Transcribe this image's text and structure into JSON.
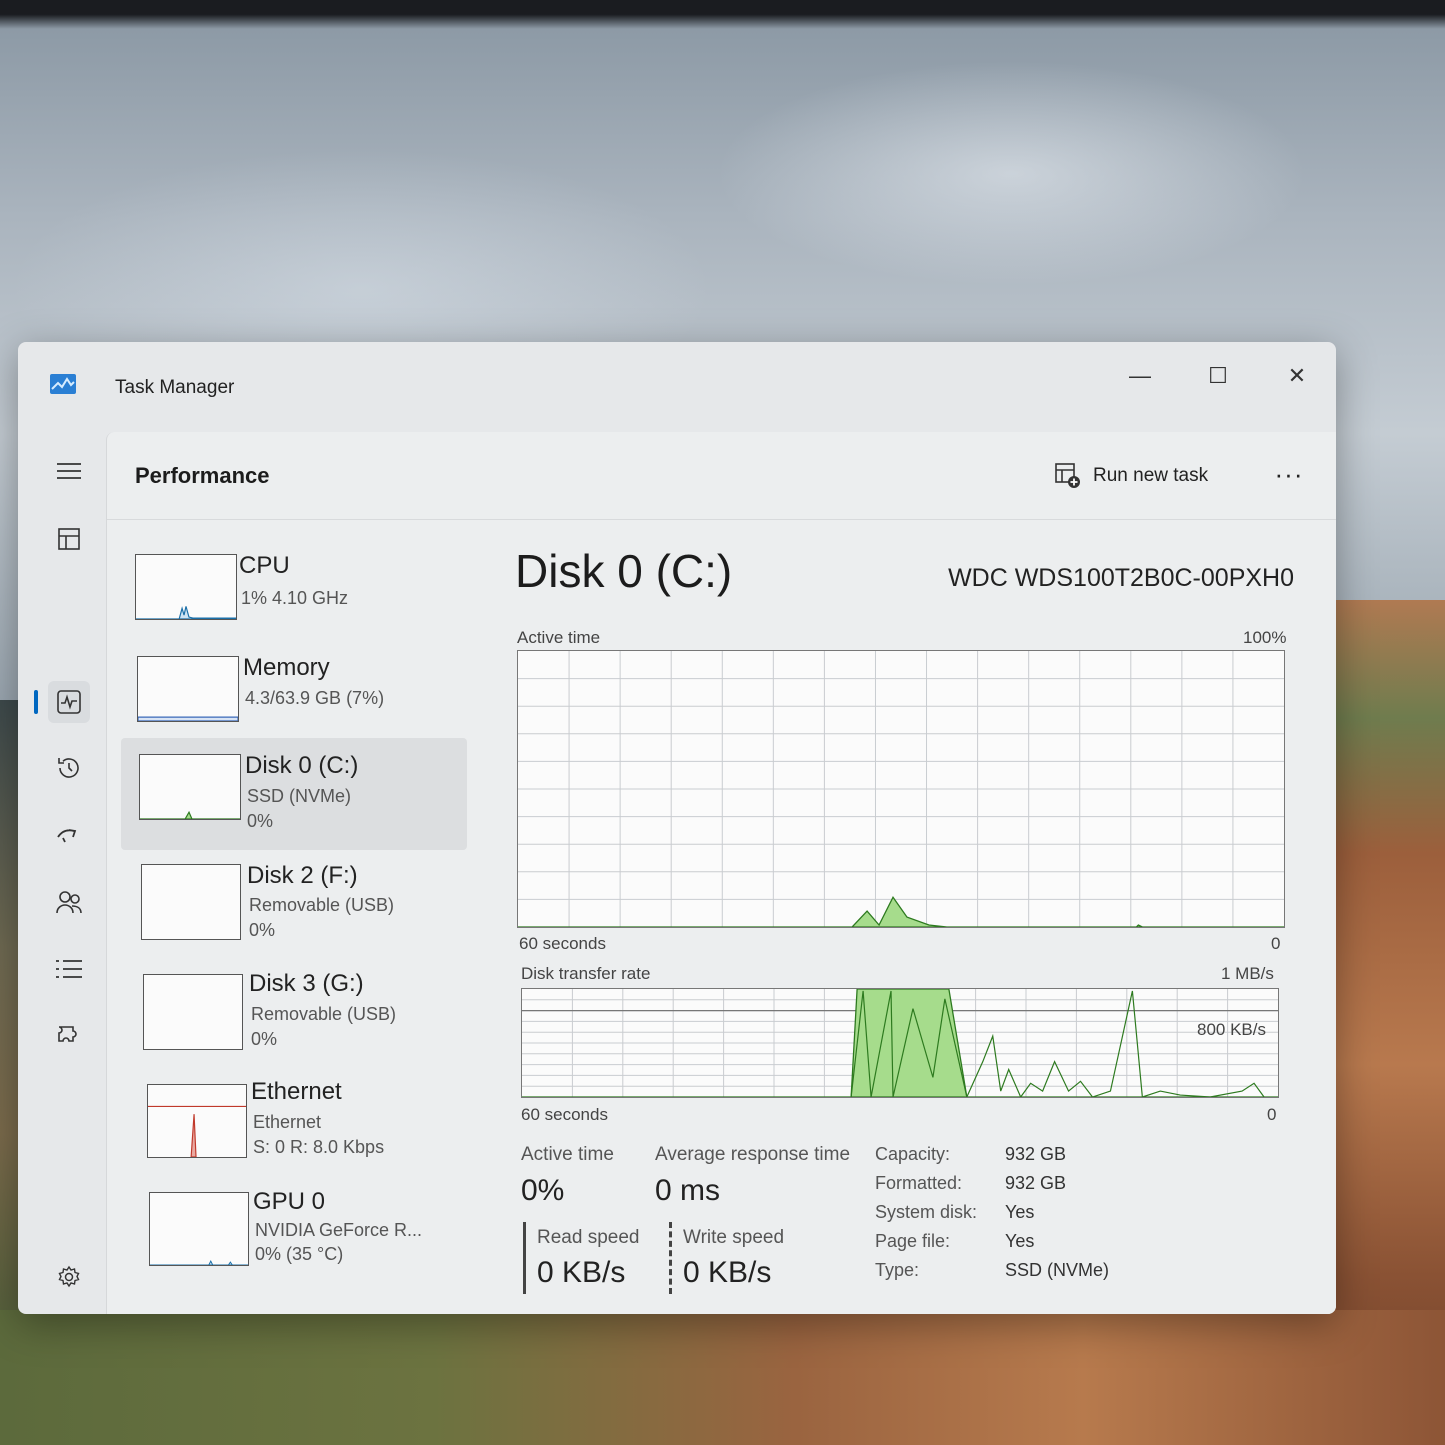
{
  "window": {
    "title": "Task Manager",
    "minimize_glyph": "—",
    "maximize_glyph": "☐",
    "close_glyph": "✕"
  },
  "header": {
    "page_title": "Performance",
    "run_new_task": "Run new task",
    "more_glyph": "···"
  },
  "nav": {
    "items": [
      {
        "icon": "hamburger-menu-icon"
      },
      {
        "icon": "processes-icon"
      },
      {
        "icon": "performance-icon",
        "active": true
      },
      {
        "icon": "app-history-icon"
      },
      {
        "icon": "startup-apps-icon"
      },
      {
        "icon": "users-icon"
      },
      {
        "icon": "details-icon"
      },
      {
        "icon": "services-icon"
      },
      {
        "icon": "settings-icon"
      }
    ]
  },
  "devices": [
    {
      "name": "CPU",
      "line1": "1% 4.10 GHz",
      "line2": ""
    },
    {
      "name": "Memory",
      "line1": "4.3/63.9 GB (7%)",
      "line2": ""
    },
    {
      "name": "Disk 0 (C:)",
      "line1": "SSD (NVMe)",
      "line2": "0%"
    },
    {
      "name": "Disk 2 (F:)",
      "line1": "Removable (USB)",
      "line2": "0%"
    },
    {
      "name": "Disk 3 (G:)",
      "line1": "Removable (USB)",
      "line2": "0%"
    },
    {
      "name": "Ethernet",
      "line1": "Ethernet",
      "line2": "S: 0 R: 8.0 Kbps"
    },
    {
      "name": "GPU 0",
      "line1": "NVIDIA GeForce R...",
      "line2": "0% (35 °C)"
    }
  ],
  "detail": {
    "title": "Disk 0 (C:)",
    "model": "WDC WDS100T2B0C-00PXH0",
    "graph1": {
      "label": "Active time",
      "max": "100%",
      "time": "60 seconds",
      "min": "0"
    },
    "graph2": {
      "label": "Disk transfer rate",
      "max": "1 MB/s",
      "mid": "800 KB/s",
      "time": "60 seconds",
      "min": "0"
    },
    "stats": {
      "active_time_label": "Active time",
      "active_time_value": "0%",
      "avg_response_label": "Average response time",
      "avg_response_value": "0 ms",
      "read_label": "Read speed",
      "read_value": "0 KB/s",
      "write_label": "Write speed",
      "write_value": "0 KB/s"
    },
    "properties": [
      {
        "k": "Capacity:",
        "v": "932 GB"
      },
      {
        "k": "Formatted:",
        "v": "932 GB"
      },
      {
        "k": "System disk:",
        "v": "Yes"
      },
      {
        "k": "Page file:",
        "v": "Yes"
      },
      {
        "k": "Type:",
        "v": "SSD (NVMe)"
      }
    ]
  },
  "colors": {
    "disk_fill": "#a6dc8c",
    "disk_stroke": "#2d7a1f",
    "cpu_line": "#1a6fa8",
    "ethernet_line": "#c0392b",
    "accent": "#0067c0"
  }
}
